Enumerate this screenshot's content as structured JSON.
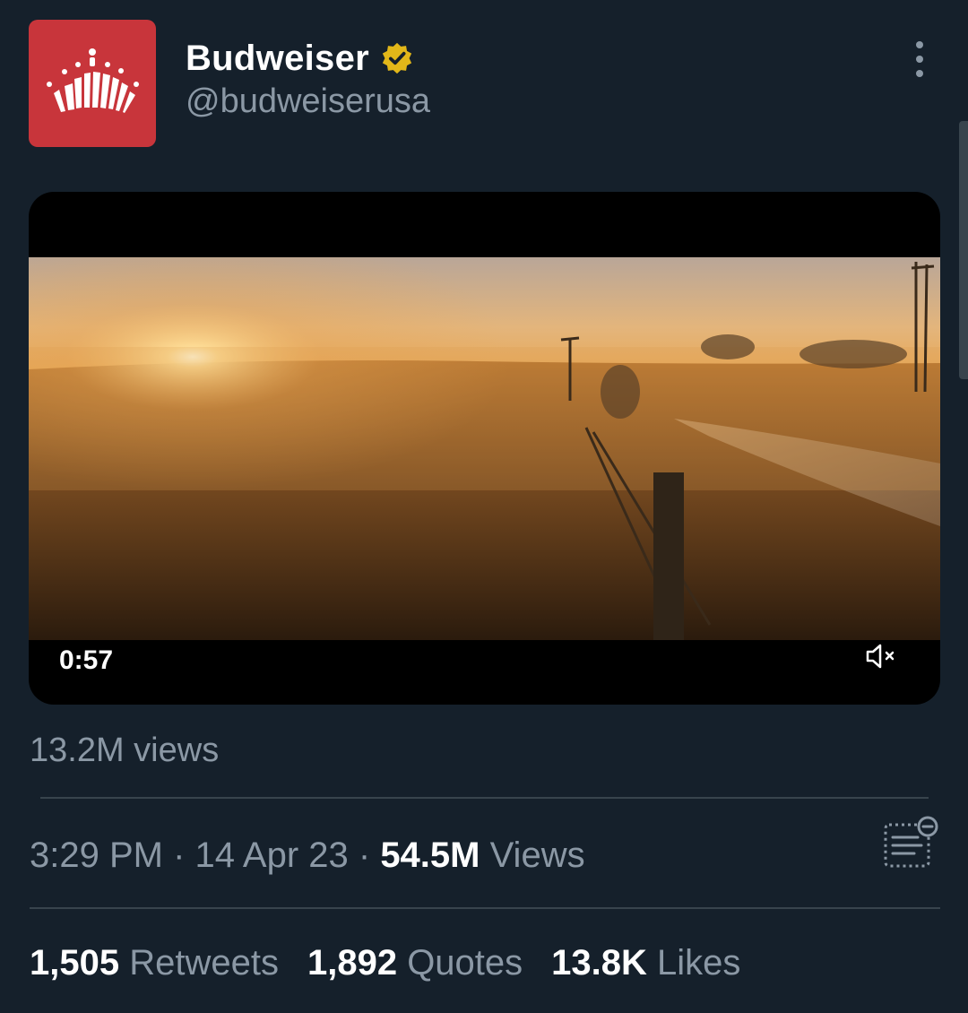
{
  "author": {
    "name": "Budweiser",
    "handle": "@budweiserusa",
    "avatar_icon": "budweiser-crown-logo",
    "verified_icon": "verified-gold-badge"
  },
  "video": {
    "duration": "0:57",
    "mute_icon": "speaker-muted-icon"
  },
  "views_line": "13.2M views",
  "meta": {
    "time": "3:29 PM",
    "sep1": " · ",
    "date": "14 Apr 23",
    "sep2": " · ",
    "views_count": "54.5M",
    "views_label": " Views",
    "analytics_icon": "analytics-icon"
  },
  "stats": {
    "retweets": {
      "count": "1,505",
      "label": " Retweets"
    },
    "quotes": {
      "count": "1,892",
      "label": " Quotes"
    },
    "likes": {
      "count": "13.8K",
      "label": " Likes"
    }
  },
  "colors": {
    "background": "#15202b",
    "secondary_text": "#8b98a5",
    "primary_text": "#ffffff",
    "divider": "#38444d",
    "avatar_red": "#c8353b",
    "verified_gold": "#e2b719"
  }
}
